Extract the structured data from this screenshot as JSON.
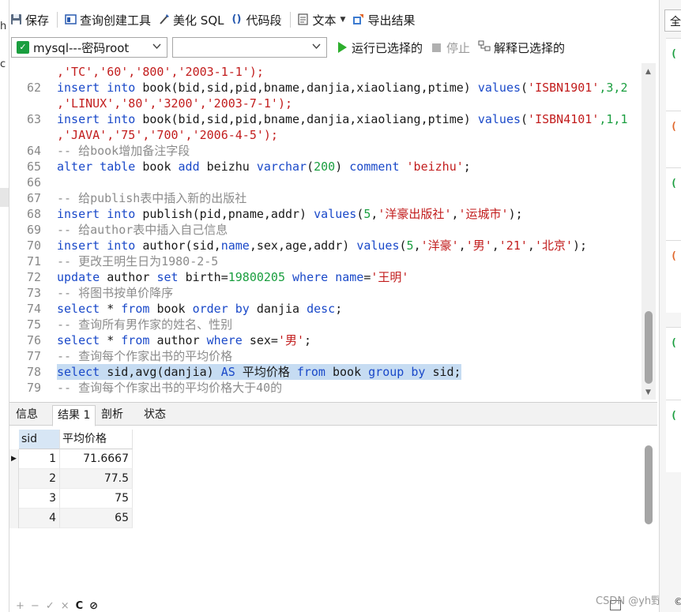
{
  "toolbar": {
    "save": "保存",
    "query_builder": "查询创建工具",
    "beautify_sql": "美化 SQL",
    "snippets": "代码段",
    "text": "文本",
    "export_results": "导出结果"
  },
  "runbar": {
    "connection": "mysql---密码root",
    "database": "",
    "run_selected": "运行已选择的",
    "stop": "停止",
    "explain_selected": "解释已选择的"
  },
  "editor": {
    "lines": [
      {
        "ln": "",
        "tokens": [
          {
            "t": ",'TC','60','800','2003-1-1');",
            "c": "str"
          }
        ]
      },
      {
        "ln": "62",
        "tokens": [
          {
            "t": "insert into ",
            "c": "kw"
          },
          {
            "t": "book(bid,sid,pid,bname,danjia,xiaoliang,ptime) ",
            "c": "tx"
          },
          {
            "t": "values",
            "c": "kw"
          },
          {
            "t": "(",
            "c": "tx"
          },
          {
            "t": "'ISBN1901'",
            "c": "str"
          },
          {
            "t": ",3,2",
            "c": "num"
          }
        ]
      },
      {
        "ln": "",
        "tokens": [
          {
            "t": ",'LINUX','80','3200','2003-7-1');",
            "c": "str"
          }
        ]
      },
      {
        "ln": "63",
        "tokens": [
          {
            "t": "insert into ",
            "c": "kw"
          },
          {
            "t": "book(bid,sid,pid,bname,danjia,xiaoliang,ptime) ",
            "c": "tx"
          },
          {
            "t": "values",
            "c": "kw"
          },
          {
            "t": "(",
            "c": "tx"
          },
          {
            "t": "'ISBN4101'",
            "c": "str"
          },
          {
            "t": ",1,1",
            "c": "num"
          }
        ]
      },
      {
        "ln": "",
        "tokens": [
          {
            "t": ",'JAVA','75','700','2006-4-5');",
            "c": "str"
          }
        ]
      },
      {
        "ln": "64",
        "tokens": [
          {
            "t": "-- 给book增加备注字段",
            "c": "cm"
          }
        ]
      },
      {
        "ln": "65",
        "tokens": [
          {
            "t": "alter table ",
            "c": "kw"
          },
          {
            "t": "book ",
            "c": "tx"
          },
          {
            "t": "add ",
            "c": "kw"
          },
          {
            "t": "beizhu ",
            "c": "tx"
          },
          {
            "t": "varchar",
            "c": "kw"
          },
          {
            "t": "(",
            "c": "tx"
          },
          {
            "t": "200",
            "c": "num"
          },
          {
            "t": ") ",
            "c": "tx"
          },
          {
            "t": "comment ",
            "c": "kw"
          },
          {
            "t": "'beizhu'",
            "c": "str"
          },
          {
            "t": ";",
            "c": "tx"
          }
        ]
      },
      {
        "ln": "66",
        "tokens": []
      },
      {
        "ln": "67",
        "tokens": [
          {
            "t": "-- 给publish表中插入新的出版社",
            "c": "cm"
          }
        ]
      },
      {
        "ln": "68",
        "tokens": [
          {
            "t": "insert into ",
            "c": "kw"
          },
          {
            "t": "publish(pid,pname,addr) ",
            "c": "tx"
          },
          {
            "t": "values",
            "c": "kw"
          },
          {
            "t": "(",
            "c": "tx"
          },
          {
            "t": "5",
            "c": "num"
          },
          {
            "t": ",",
            "c": "tx"
          },
          {
            "t": "'洋豪出版社'",
            "c": "str"
          },
          {
            "t": ",",
            "c": "tx"
          },
          {
            "t": "'运城市'",
            "c": "str"
          },
          {
            "t": ");",
            "c": "tx"
          }
        ]
      },
      {
        "ln": "69",
        "tokens": [
          {
            "t": "-- 给author表中插入自己信息",
            "c": "cm"
          }
        ]
      },
      {
        "ln": "70",
        "tokens": [
          {
            "t": "insert into ",
            "c": "kw"
          },
          {
            "t": "author(sid,",
            "c": "tx"
          },
          {
            "t": "name",
            "c": "kw"
          },
          {
            "t": ",sex,age,addr) ",
            "c": "tx"
          },
          {
            "t": "values",
            "c": "kw"
          },
          {
            "t": "(",
            "c": "tx"
          },
          {
            "t": "5",
            "c": "num"
          },
          {
            "t": ",",
            "c": "tx"
          },
          {
            "t": "'洋豪'",
            "c": "str"
          },
          {
            "t": ",",
            "c": "tx"
          },
          {
            "t": "'男'",
            "c": "str"
          },
          {
            "t": ",",
            "c": "tx"
          },
          {
            "t": "'21'",
            "c": "str"
          },
          {
            "t": ",",
            "c": "tx"
          },
          {
            "t": "'北京'",
            "c": "str"
          },
          {
            "t": ");",
            "c": "tx"
          }
        ]
      },
      {
        "ln": "71",
        "tokens": [
          {
            "t": "-- 更改王明生日为1980-2-5",
            "c": "cm"
          }
        ]
      },
      {
        "ln": "72",
        "tokens": [
          {
            "t": "update ",
            "c": "kw"
          },
          {
            "t": "author ",
            "c": "tx"
          },
          {
            "t": "set ",
            "c": "kw"
          },
          {
            "t": "birth=",
            "c": "tx"
          },
          {
            "t": "19800205 ",
            "c": "num"
          },
          {
            "t": "where ",
            "c": "kw"
          },
          {
            "t": "name",
            "c": "kw"
          },
          {
            "t": "=",
            "c": "tx"
          },
          {
            "t": "'王明'",
            "c": "str"
          }
        ]
      },
      {
        "ln": "73",
        "tokens": [
          {
            "t": "-- 将图书按单价降序",
            "c": "cm"
          }
        ]
      },
      {
        "ln": "74",
        "tokens": [
          {
            "t": "select ",
            "c": "kw"
          },
          {
            "t": "* ",
            "c": "tx"
          },
          {
            "t": "from ",
            "c": "kw"
          },
          {
            "t": "book ",
            "c": "tx"
          },
          {
            "t": "order by ",
            "c": "kw"
          },
          {
            "t": "danjia ",
            "c": "tx"
          },
          {
            "t": "desc",
            "c": "kw"
          },
          {
            "t": ";",
            "c": "tx"
          }
        ]
      },
      {
        "ln": "75",
        "tokens": [
          {
            "t": "-- 查询所有男作家的姓名、性别",
            "c": "cm"
          }
        ]
      },
      {
        "ln": "76",
        "tokens": [
          {
            "t": "select ",
            "c": "kw"
          },
          {
            "t": "* ",
            "c": "tx"
          },
          {
            "t": "from ",
            "c": "kw"
          },
          {
            "t": "author ",
            "c": "tx"
          },
          {
            "t": "where ",
            "c": "kw"
          },
          {
            "t": "sex=",
            "c": "tx"
          },
          {
            "t": "'男'",
            "c": "str"
          },
          {
            "t": ";",
            "c": "tx"
          }
        ]
      },
      {
        "ln": "77",
        "tokens": [
          {
            "t": "-- 查询每个作家出书的平均价格",
            "c": "cm"
          }
        ]
      },
      {
        "ln": "78",
        "highlight": true,
        "tokens": [
          {
            "t": "select ",
            "c": "kw"
          },
          {
            "t": "sid,avg(danjia) ",
            "c": "tx"
          },
          {
            "t": "AS ",
            "c": "kw"
          },
          {
            "t": "平均价格 ",
            "c": "tx"
          },
          {
            "t": "from ",
            "c": "kw"
          },
          {
            "t": "book ",
            "c": "tx"
          },
          {
            "t": "group by ",
            "c": "kw"
          },
          {
            "t": "sid;",
            "c": "tx"
          }
        ]
      },
      {
        "ln": "79",
        "tokens": [
          {
            "t": "-- 查询每个作家出书的平均价格大于40的",
            "c": "cm"
          }
        ]
      }
    ]
  },
  "result_tabs": [
    "信息",
    "结果 1",
    "剖析",
    "状态"
  ],
  "result_grid": {
    "columns": [
      "sid",
      "平均价格"
    ],
    "rows": [
      [
        "1",
        "71.6667"
      ],
      [
        "2",
        "77.5"
      ],
      [
        "3",
        "75"
      ],
      [
        "4",
        "65"
      ]
    ]
  },
  "bottombar": {
    "buttons": [
      "+",
      "−",
      "✓",
      "×",
      "C",
      "⊘"
    ]
  },
  "left_strip": {
    "chars": [
      "h",
      "c"
    ]
  },
  "right_strip": {
    "top_label": "全",
    "item_icon": "(",
    "bottom_label": "©"
  },
  "watermark": "CSDN @yh野良",
  "colors": {
    "keyword": "#1a49c9",
    "string": "#c21d1d",
    "number": "#1a9e3f",
    "comment": "#8c8c8c",
    "selection": "#c6dcf2"
  }
}
